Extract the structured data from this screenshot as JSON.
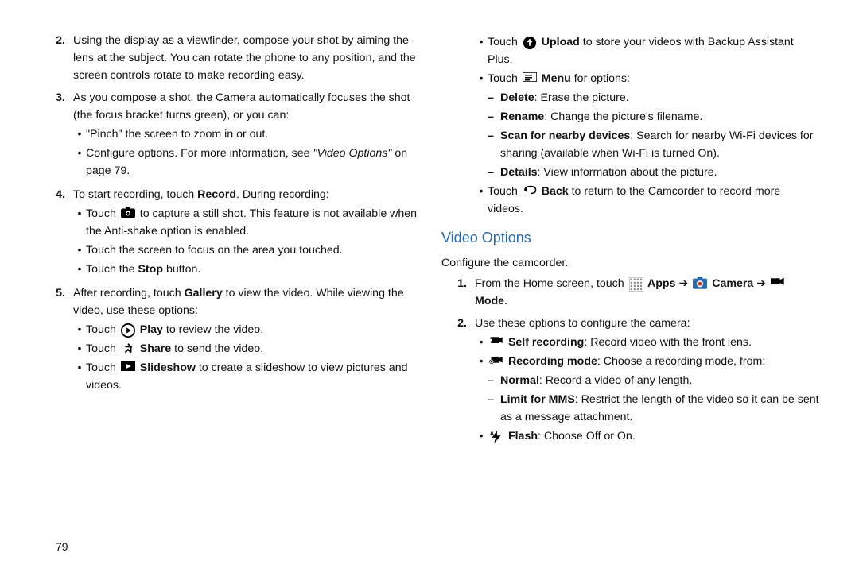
{
  "pageNumber": "79",
  "left": {
    "items": [
      {
        "num": "2.",
        "text": "Using the display as a viewfinder, compose your shot by aiming the lens at the subject. You can rotate the phone to any position, and the screen controls rotate to make recording easy."
      },
      {
        "num": "3.",
        "text": "As you compose a shot, the Camera automatically focuses the shot (the focus bracket turns green), or you can:",
        "sub": [
          {
            "pre": "\"Pinch\" the screen",
            "post": " to zoom in or out."
          },
          {
            "pre": "Configure options. For more information, see ",
            "ital": "\"Video Options\"",
            "post": " on page 79."
          }
        ]
      },
      {
        "num": "4.",
        "pre": "To start recording, touch ",
        "bold": "Record",
        "post": ". During recording:",
        "sub": [
          {
            "pre": "Touch ",
            "icon": "camera",
            "post": " to capture a still shot. This feature is not available when the Anti-shake option is enabled."
          },
          {
            "plain": "Touch the screen to focus on the area you touched."
          },
          {
            "pre": "Touch the ",
            "bold": "Stop",
            "post": " button."
          }
        ]
      },
      {
        "num": "5.",
        "pre": "After recording, touch ",
        "bold": "Gallery",
        "post": " to view the video. While viewing the video, use these options:",
        "sub": [
          {
            "pre": "Touch ",
            "icon": "play-circle",
            "bold": " Play",
            "post": " to review the video."
          },
          {
            "pre": "Touch ",
            "icon": "share",
            "bold": " Share",
            "post": " to send the video."
          },
          {
            "pre": "Touch ",
            "icon": "slideshow",
            "bold": " Slideshow",
            "post": " to create a slideshow to view pictures and videos."
          }
        ]
      }
    ]
  },
  "right": {
    "topBullets": [
      {
        "pre": "Touch ",
        "icon": "upload",
        "bold": " Upload",
        "post": " to store your videos with Backup Assistant Plus."
      },
      {
        "pre": "Touch ",
        "icon": "menu",
        "bold": " Menu",
        "post": " for options:",
        "dash": [
          {
            "bold": "Delete",
            "post": ": Erase the picture."
          },
          {
            "bold": "Rename",
            "post": ": Change the picture's filename."
          },
          {
            "bold": "Scan for nearby devices",
            "post": ": Search for nearby Wi-Fi devices for sharing (available when Wi-Fi is turned On)."
          },
          {
            "bold": "Details",
            "post": ": View information about the picture."
          }
        ]
      },
      {
        "pre": "Touch ",
        "icon": "back",
        "bold": " Back",
        "post": " to return to the Camcorder to record more videos."
      }
    ],
    "heading": "Video Options",
    "intro": "Configure the camcorder.",
    "ol": [
      {
        "num": "1.",
        "segments": [
          {
            "t": "From the Home screen, touch "
          },
          {
            "icon": "apps-grid"
          },
          {
            "bold": " Apps "
          },
          {
            "t": "➔ "
          },
          {
            "icon": "camera-color"
          },
          {
            "bold": " Camera "
          },
          {
            "t": "➔ "
          },
          {
            "icon": "mode"
          },
          {
            "bold": " Mode"
          },
          {
            "t": "."
          }
        ]
      },
      {
        "num": "2.",
        "text": "Use these options to configure the camera:",
        "sub": [
          {
            "icon": "self-rec",
            "bold": " Self recording",
            "post": ": Record video with the front lens."
          },
          {
            "icon": "rec-mode",
            "bold": " Recording mode",
            "post": ": Choose a recording mode, from:",
            "dash": [
              {
                "bold": "Normal",
                "post": ": Record a video of any length."
              },
              {
                "bold": "Limit for MMS",
                "post": ": Restrict the length of the video so it can be sent as a message attachment."
              }
            ]
          },
          {
            "icon": "flash",
            "bold": " Flash",
            "post": ": Choose Off or On."
          }
        ]
      }
    ]
  }
}
